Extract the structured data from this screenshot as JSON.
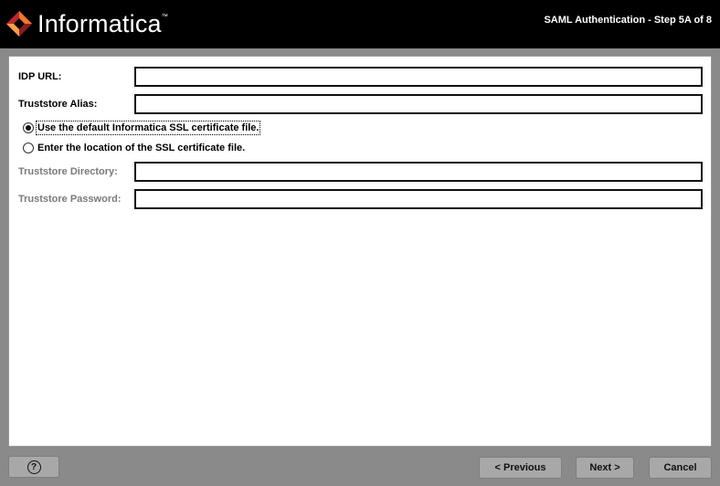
{
  "header": {
    "logo_text": "Informatica",
    "logo_tm": "™",
    "step_title": "SAML Authentication - Step 5A of 8",
    "logo_colors": {
      "orange": "#e8622a",
      "red": "#c1272d",
      "dark": "#8b1c1f"
    }
  },
  "form": {
    "idp_url": {
      "label": "IDP URL:",
      "value": ""
    },
    "truststore_alias": {
      "label": "Truststore Alias:",
      "value": ""
    },
    "radio_default": {
      "label": "Use the default Informatica SSL certificate file.",
      "checked": true
    },
    "radio_custom": {
      "label": "Enter the location of the SSL certificate file.",
      "checked": false
    },
    "truststore_directory": {
      "label": "Truststore Directory:",
      "value": ""
    },
    "truststore_password": {
      "label": "Truststore Password:",
      "value": ""
    }
  },
  "footer": {
    "help_label": "?",
    "previous_label": "< Previous",
    "next_label": "Next >",
    "cancel_label": "Cancel"
  }
}
